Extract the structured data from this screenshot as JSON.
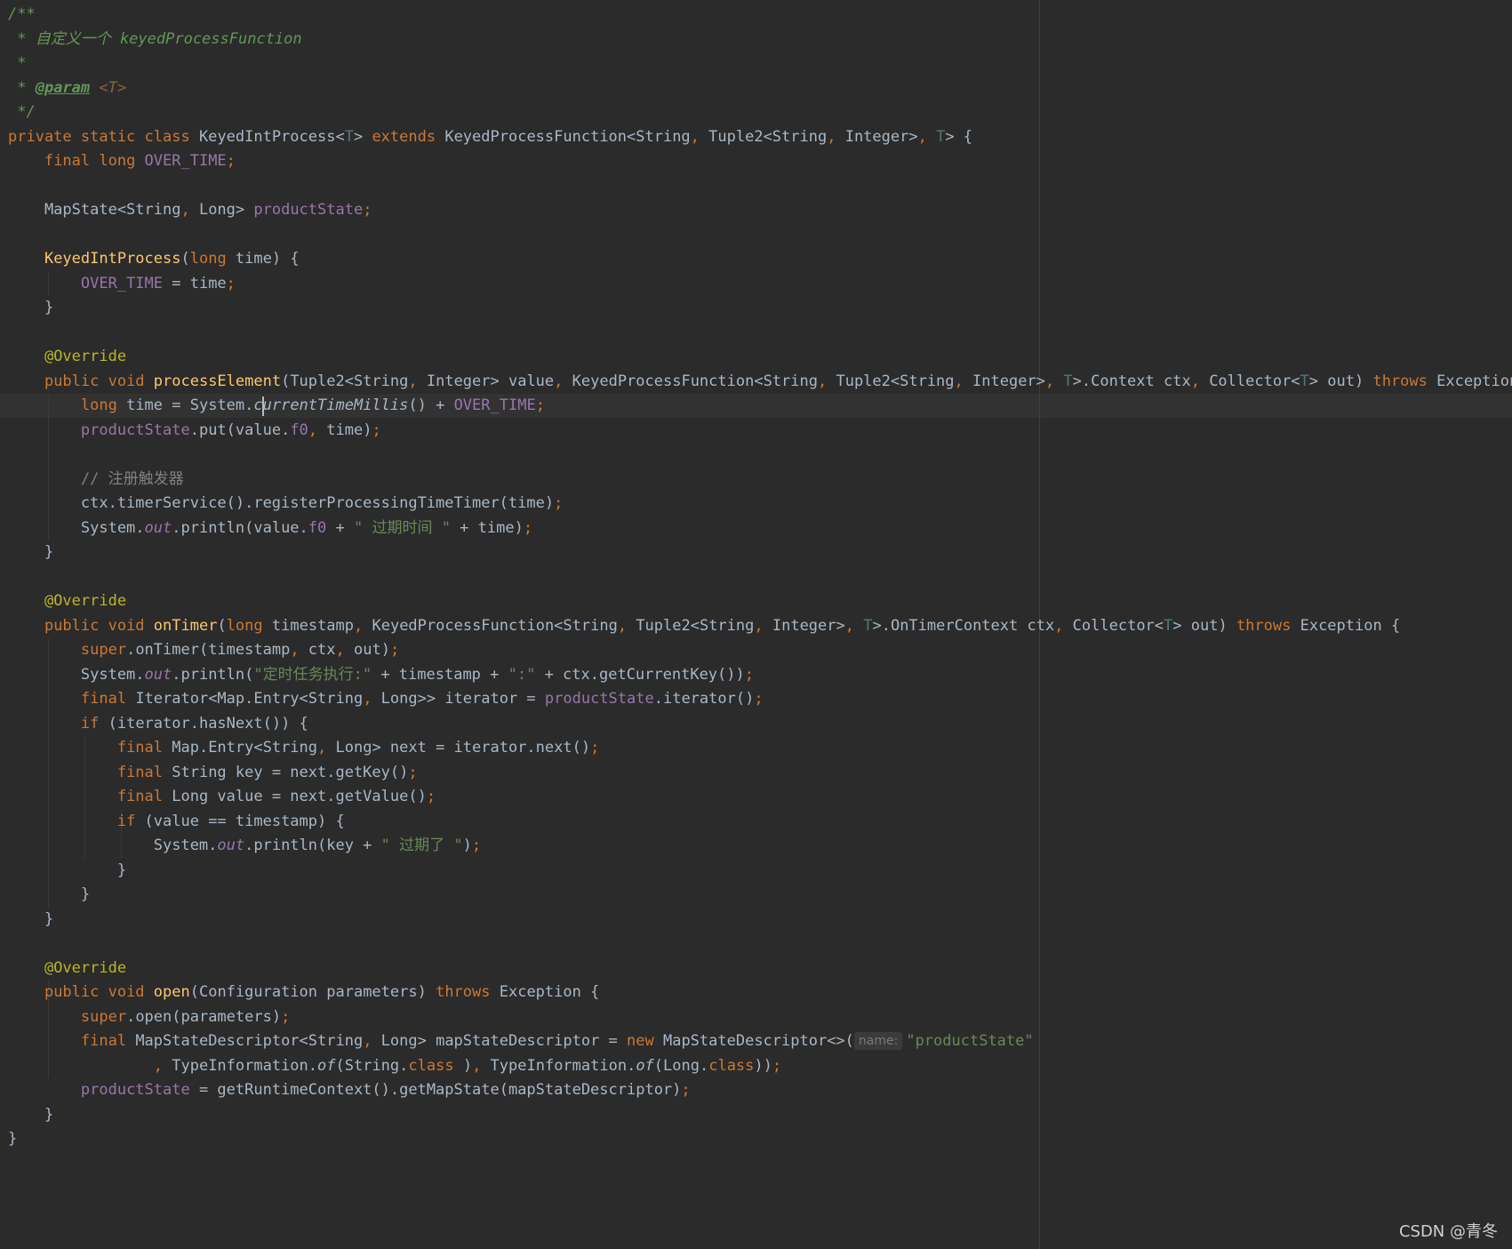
{
  "editor": {
    "language": "Java",
    "theme_colors": {
      "background": "#2b2b2b",
      "keyword": "#cc7832",
      "field": "#9876aa",
      "method_declaration": "#ffc66d",
      "string": "#6a8759",
      "annotation": "#bbb529",
      "type_parameter": "#507874",
      "comment": "#808080",
      "doc_comment": "#629755",
      "default_text": "#a9b7c6"
    },
    "lines": [
      [
        [
          "doc",
          "/**"
        ]
      ],
      [
        [
          "doc",
          " * 自定义一个 keyedProcessFunction"
        ]
      ],
      [
        [
          "doc",
          " *"
        ]
      ],
      [
        [
          "doc",
          " * "
        ],
        [
          "doctag",
          "@param"
        ],
        [
          "doc",
          " "
        ],
        [
          "docparam",
          "<T>"
        ]
      ],
      [
        [
          "doc",
          " */"
        ]
      ],
      [
        [
          "kw",
          "private static class "
        ],
        [
          "",
          "KeyedIntProcess<"
        ],
        [
          "tp",
          "T"
        ],
        [
          "",
          "> "
        ],
        [
          "kw",
          "extends "
        ],
        [
          "",
          "KeyedProcessFunction<String"
        ],
        [
          "kw",
          ", "
        ],
        [
          "",
          "Tuple2<String"
        ],
        [
          "kw",
          ", "
        ],
        [
          "",
          "Integer>"
        ],
        [
          "kw",
          ", "
        ],
        [
          "tp",
          "T"
        ],
        [
          "",
          "> {"
        ]
      ],
      [
        [
          "",
          "    "
        ],
        [
          "kw",
          "final long "
        ],
        [
          "fld",
          "OVER_TIME"
        ],
        [
          "kw",
          ";"
        ]
      ],
      [],
      [
        [
          "",
          "    MapState<String"
        ],
        [
          "kw",
          ", "
        ],
        [
          "",
          "Long> "
        ],
        [
          "fld",
          "productState"
        ],
        [
          "kw",
          ";"
        ]
      ],
      [],
      [
        [
          "",
          "    "
        ],
        [
          "fn",
          "KeyedIntProcess"
        ],
        [
          "",
          "("
        ],
        [
          "kw",
          "long "
        ],
        [
          "",
          "time) {"
        ]
      ],
      [
        [
          "",
          "        "
        ],
        [
          "fld",
          "OVER_TIME "
        ],
        [
          "",
          "= time"
        ],
        [
          "kw",
          ";"
        ]
      ],
      [
        [
          "",
          "    }"
        ]
      ],
      [],
      [
        [
          "",
          "    "
        ],
        [
          "ann",
          "@Override"
        ]
      ],
      [
        [
          "",
          "    "
        ],
        [
          "kw",
          "public void "
        ],
        [
          "fn",
          "processElement"
        ],
        [
          "",
          "(Tuple2<String"
        ],
        [
          "kw",
          ", "
        ],
        [
          "",
          "Integer> value"
        ],
        [
          "kw",
          ", "
        ],
        [
          "",
          "KeyedProcessFunction<String"
        ],
        [
          "kw",
          ", "
        ],
        [
          "",
          "Tuple2<String"
        ],
        [
          "kw",
          ", "
        ],
        [
          "",
          "Integer>"
        ],
        [
          "kw",
          ", "
        ],
        [
          "tp",
          "T"
        ],
        [
          "",
          ">.Context ctx"
        ],
        [
          "kw",
          ", "
        ],
        [
          "",
          "Collector<"
        ],
        [
          "tp",
          "T"
        ],
        [
          "",
          "> out) "
        ],
        [
          "kw",
          "throws "
        ],
        [
          "",
          "Exception {"
        ]
      ],
      [
        [
          "",
          "        "
        ],
        [
          "kw",
          "long "
        ],
        [
          "",
          "time = System."
        ],
        [
          "stat",
          "currentTimeMillis"
        ],
        [
          "",
          "() + "
        ],
        [
          "fld",
          "OVER_TIME"
        ],
        [
          "kw",
          ";"
        ]
      ],
      [
        [
          "",
          "        "
        ],
        [
          "fld",
          "productState"
        ],
        [
          "",
          ".put(value."
        ],
        [
          "fld",
          "f0"
        ],
        [
          "kw",
          ", "
        ],
        [
          "",
          "time)"
        ],
        [
          "kw",
          ";"
        ]
      ],
      [],
      [
        [
          "",
          "        "
        ],
        [
          "cmt",
          "// 注册触发器"
        ]
      ],
      [
        [
          "",
          "        ctx.timerService().registerProcessingTimeTimer(time)"
        ],
        [
          "kw",
          ";"
        ]
      ],
      [
        [
          "",
          "        System."
        ],
        [
          "statfld",
          "out"
        ],
        [
          "",
          ".println(value."
        ],
        [
          "fld",
          "f0"
        ],
        [
          "",
          " + "
        ],
        [
          "str",
          "\" 过期时间 \""
        ],
        [
          "",
          " + time)"
        ],
        [
          "kw",
          ";"
        ]
      ],
      [
        [
          "",
          "    }"
        ]
      ],
      [],
      [
        [
          "",
          "    "
        ],
        [
          "ann",
          "@Override"
        ]
      ],
      [
        [
          "",
          "    "
        ],
        [
          "kw",
          "public void "
        ],
        [
          "fn",
          "onTimer"
        ],
        [
          "",
          "("
        ],
        [
          "kw",
          "long "
        ],
        [
          "",
          "timestamp"
        ],
        [
          "kw",
          ", "
        ],
        [
          "",
          "KeyedProcessFunction<String"
        ],
        [
          "kw",
          ", "
        ],
        [
          "",
          "Tuple2<String"
        ],
        [
          "kw",
          ", "
        ],
        [
          "",
          "Integer>"
        ],
        [
          "kw",
          ", "
        ],
        [
          "tp",
          "T"
        ],
        [
          "",
          ">.OnTimerContext ctx"
        ],
        [
          "kw",
          ", "
        ],
        [
          "",
          "Collector<"
        ],
        [
          "tp",
          "T"
        ],
        [
          "",
          "> out) "
        ],
        [
          "kw",
          "throws "
        ],
        [
          "",
          "Exception {"
        ]
      ],
      [
        [
          "",
          "        "
        ],
        [
          "kw",
          "super"
        ],
        [
          "",
          ".onTimer(timestamp"
        ],
        [
          "kw",
          ", "
        ],
        [
          "",
          "ctx"
        ],
        [
          "kw",
          ", "
        ],
        [
          "",
          "out)"
        ],
        [
          "kw",
          ";"
        ]
      ],
      [
        [
          "",
          "        System."
        ],
        [
          "statfld",
          "out"
        ],
        [
          "",
          ".println("
        ],
        [
          "str",
          "\"定时任务执行:\""
        ],
        [
          "",
          " + timestamp + "
        ],
        [
          "str",
          "\":\""
        ],
        [
          "",
          " + ctx.getCurrentKey())"
        ],
        [
          "kw",
          ";"
        ]
      ],
      [
        [
          "",
          "        "
        ],
        [
          "kw",
          "final "
        ],
        [
          "",
          "Iterator<Map.Entry<String"
        ],
        [
          "kw",
          ", "
        ],
        [
          "",
          "Long>> iterator = "
        ],
        [
          "fld",
          "productState"
        ],
        [
          "",
          ".iterator()"
        ],
        [
          "kw",
          ";"
        ]
      ],
      [
        [
          "",
          "        "
        ],
        [
          "kw",
          "if "
        ],
        [
          "",
          "(iterator.hasNext()) {"
        ]
      ],
      [
        [
          "",
          "            "
        ],
        [
          "kw",
          "final "
        ],
        [
          "",
          "Map.Entry<String"
        ],
        [
          "kw",
          ", "
        ],
        [
          "",
          "Long> next = iterator.next()"
        ],
        [
          "kw",
          ";"
        ]
      ],
      [
        [
          "",
          "            "
        ],
        [
          "kw",
          "final "
        ],
        [
          "",
          "String key = next.getKey()"
        ],
        [
          "kw",
          ";"
        ]
      ],
      [
        [
          "",
          "            "
        ],
        [
          "kw",
          "final "
        ],
        [
          "",
          "Long value = next.getValue()"
        ],
        [
          "kw",
          ";"
        ]
      ],
      [
        [
          "",
          "            "
        ],
        [
          "kw",
          "if "
        ],
        [
          "",
          "(value == timestamp) {"
        ]
      ],
      [
        [
          "",
          "                System."
        ],
        [
          "statfld",
          "out"
        ],
        [
          "",
          ".println(key + "
        ],
        [
          "str",
          "\" 过期了 \""
        ],
        [
          "",
          ")"
        ],
        [
          "kw",
          ";"
        ]
      ],
      [
        [
          "",
          "            }"
        ]
      ],
      [
        [
          "",
          "        }"
        ]
      ],
      [
        [
          "",
          "    }"
        ]
      ],
      [],
      [
        [
          "",
          "    "
        ],
        [
          "ann",
          "@Override"
        ]
      ],
      [
        [
          "",
          "    "
        ],
        [
          "kw",
          "public void "
        ],
        [
          "fn",
          "open"
        ],
        [
          "",
          "(Configuration parameters) "
        ],
        [
          "kw",
          "throws "
        ],
        [
          "",
          "Exception {"
        ]
      ],
      [
        [
          "",
          "        "
        ],
        [
          "kw",
          "super"
        ],
        [
          "",
          ".open(parameters)"
        ],
        [
          "kw",
          ";"
        ]
      ],
      [
        [
          "",
          "        "
        ],
        [
          "kw",
          "final "
        ],
        [
          "",
          "MapStateDescriptor<String"
        ],
        [
          "kw",
          ", "
        ],
        [
          "",
          "Long> mapStateDescriptor = "
        ],
        [
          "kw",
          "new "
        ],
        [
          "",
          "MapStateDescriptor<>("
        ],
        [
          "hint",
          "name:"
        ],
        [
          "str",
          "\"productState\""
        ]
      ],
      [
        [
          "",
          "                "
        ],
        [
          "kw",
          ", "
        ],
        [
          "",
          "TypeInformation."
        ],
        [
          "stat",
          "of"
        ],
        [
          "",
          "(String."
        ],
        [
          "kw",
          "class"
        ],
        [
          "",
          " )"
        ],
        [
          "kw",
          ", "
        ],
        [
          "",
          "TypeInformation."
        ],
        [
          "stat",
          "of"
        ],
        [
          "",
          "(Long."
        ],
        [
          "kw",
          "class"
        ],
        [
          "",
          "))"
        ],
        [
          "kw",
          ";"
        ]
      ],
      [
        [
          "",
          "        "
        ],
        [
          "fld",
          "productState "
        ],
        [
          "",
          "= getRuntimeContext().getMapState(mapStateDescriptor)"
        ],
        [
          "kw",
          ";"
        ]
      ],
      [
        [
          "",
          "    }"
        ]
      ],
      [
        [
          "",
          "}"
        ]
      ]
    ]
  },
  "watermark": {
    "text": "CSDN @青冬"
  }
}
